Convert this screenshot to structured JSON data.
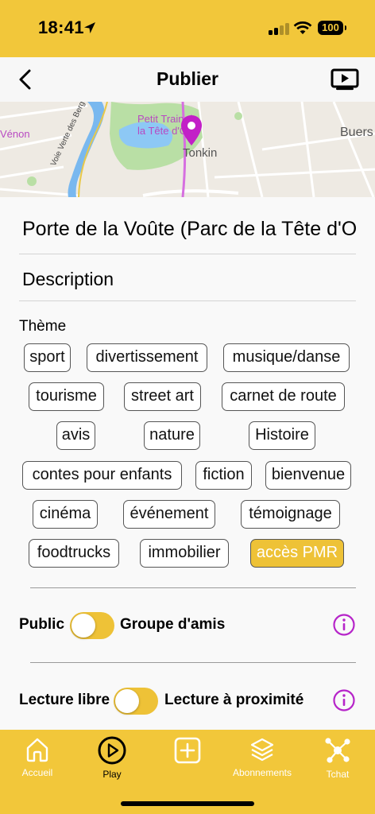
{
  "status": {
    "time": "18:41",
    "battery": "100"
  },
  "header": {
    "title": "Publier"
  },
  "map": {
    "labels": {
      "park": "Petit Train de la Tête d'Or",
      "tonkin": "Tonkin",
      "buers": "Buers",
      "venon": "Vénon",
      "road": "Voie Verte des Berges du Rhône"
    }
  },
  "form": {
    "place_title": "Porte de la Voûte (Parc de la Tête d'Or)",
    "description_label": "Description",
    "theme_label": "Thème",
    "themes": [
      "sport",
      "divertissement",
      "musique/danse",
      "tourisme",
      "street art",
      "carnet de route",
      "avis",
      "nature",
      "Histoire",
      "contes pour enfants",
      "fiction",
      "bienvenue",
      "cinéma",
      "événement",
      "témoignage",
      "foodtrucks",
      "immobilier",
      "accès PMR"
    ],
    "selected_theme": "accès PMR",
    "visibility": {
      "left": "Public",
      "right": "Groupe d'amis"
    },
    "reading": {
      "left": "Lecture libre",
      "right": "Lecture à proximité"
    }
  },
  "tabs": [
    {
      "label": "Accueil",
      "icon": "home-icon"
    },
    {
      "label": "Play",
      "icon": "play-icon"
    },
    {
      "label": "",
      "icon": "add-icon"
    },
    {
      "label": "Abonnements",
      "icon": "layers-icon"
    },
    {
      "label": "Tchat",
      "icon": "network-icon"
    }
  ],
  "colors": {
    "accent": "#f2c73a",
    "info": "#b624c9",
    "pin": "#c21fc7"
  }
}
